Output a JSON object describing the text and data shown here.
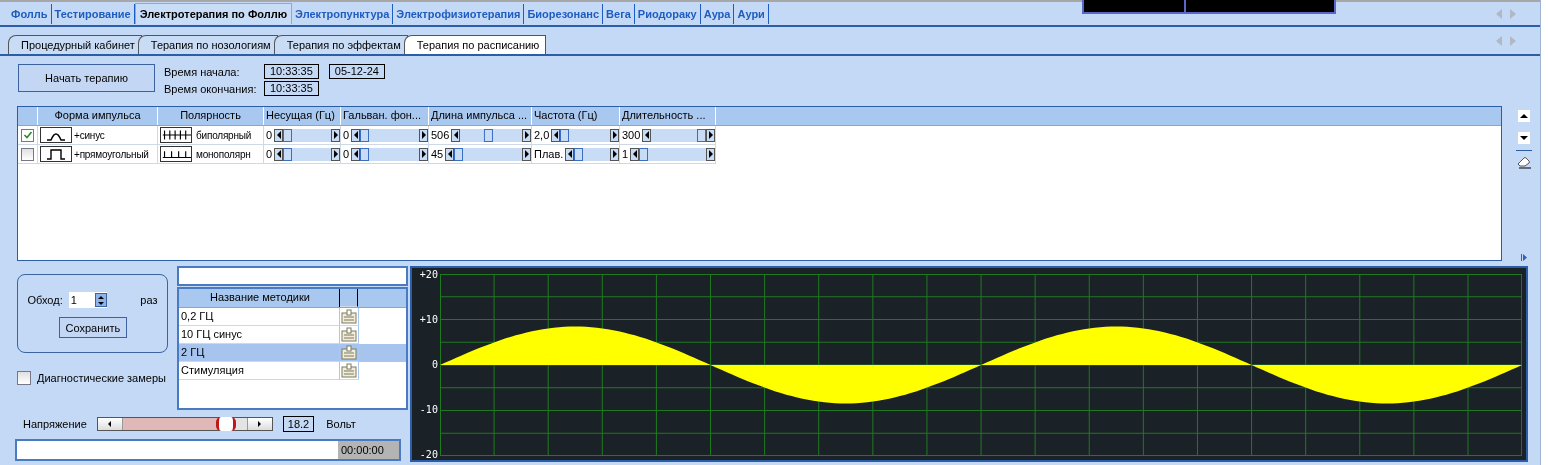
{
  "top_tabs": [
    {
      "label": "Фолль",
      "selected": false
    },
    {
      "label": "Тестирование",
      "selected": false
    },
    {
      "label": "Электротерапия по Фоллю",
      "selected": true
    },
    {
      "label": "Электропунктура",
      "selected": false
    },
    {
      "label": "Электрофизиотерапия",
      "selected": false
    },
    {
      "label": "Биорезонанс",
      "selected": false
    },
    {
      "label": "Вега",
      "selected": false
    },
    {
      "label": "Риодораку",
      "selected": false
    },
    {
      "label": "Аура",
      "selected": false
    },
    {
      "label": "Аури",
      "selected": false
    }
  ],
  "sub_tabs": [
    {
      "label": "Процедурный кабинет",
      "selected": false
    },
    {
      "label": "Терапия по нозологиям",
      "selected": false
    },
    {
      "label": "Терапия по эффектам",
      "selected": false
    },
    {
      "label": "Терапия по расписанию",
      "selected": true
    }
  ],
  "start_button": "Начать терапию",
  "start_time_label": "Время начала:",
  "start_time": "10:33:35",
  "date": "05-12-24",
  "end_time_label": "Время окончания:",
  "end_time": "10:33:35",
  "table": {
    "columns": [
      "Форма импульса",
      "Полярность",
      "Несущая (Гц)",
      "Гальван. фон...",
      "Длина импульса ...",
      "Частота (Гц)",
      "Длительность ..."
    ],
    "rows": [
      {
        "checked": true,
        "form": {
          "kind": "sine",
          "label": "+синус"
        },
        "polarity": {
          "kind": "bipolar",
          "label": "биполярный"
        },
        "params": [
          {
            "value": "0",
            "level": 0
          },
          {
            "value": "0",
            "level": 0
          },
          {
            "value": "506",
            "level": 0.45
          },
          {
            "value": "2,0",
            "level": 0
          },
          {
            "value": "300",
            "level": 1
          }
        ]
      },
      {
        "checked": false,
        "form": {
          "kind": "rect",
          "label": "+прямоугольный"
        },
        "polarity": {
          "kind": "mono",
          "label": "монополярн"
        },
        "params": [
          {
            "value": "0",
            "level": 0
          },
          {
            "value": "0",
            "level": 0
          },
          {
            "value": "45",
            "level": 0
          },
          {
            "value": "Плав.",
            "level": 0
          },
          {
            "value": "1",
            "level": 0
          }
        ]
      }
    ]
  },
  "passes": {
    "label": "Обход:",
    "value": "1",
    "unit": "раз",
    "save_button": "Сохранить"
  },
  "diagnostics": {
    "label": "Диагностические замеры",
    "checked": false
  },
  "methods": {
    "column": "Название методики",
    "rows": [
      {
        "name": "0,2 ГЦ",
        "selected": false
      },
      {
        "name": "10 ГЦ синус",
        "selected": false
      },
      {
        "name": "2 ГЦ",
        "selected": true
      },
      {
        "name": "Стимуляция",
        "selected": false
      }
    ]
  },
  "voltage": {
    "label": "Напряжение",
    "level": 0.85,
    "value": "18.2",
    "unit": "Вольт"
  },
  "progress": {
    "level": 0,
    "time": "00:00:00"
  },
  "scope": {
    "y_labels": [
      "+20",
      "+10",
      "0",
      "-10",
      "-20"
    ]
  }
}
